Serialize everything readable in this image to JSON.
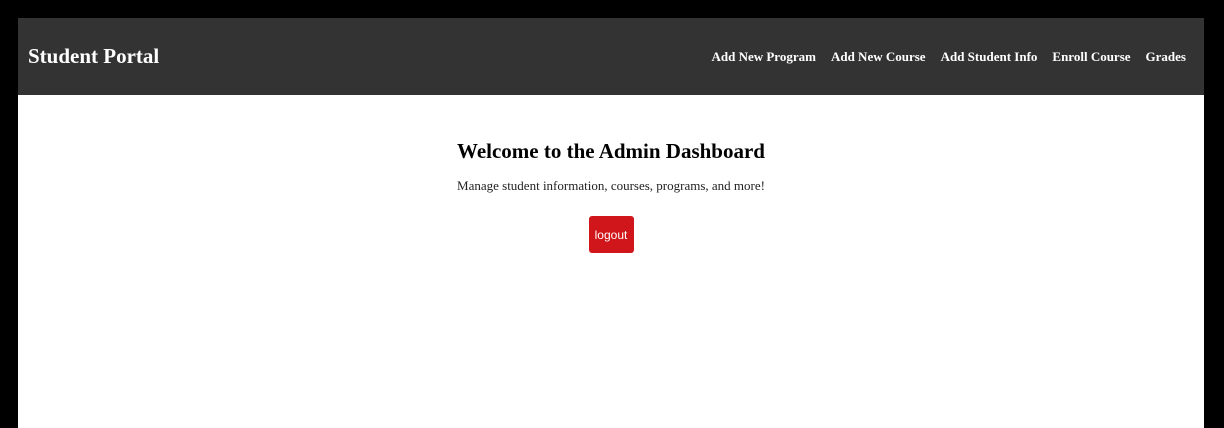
{
  "navbar": {
    "brand": "Student Portal",
    "links": [
      {
        "label": "Add New Program"
      },
      {
        "label": "Add New Course"
      },
      {
        "label": "Add Student Info"
      },
      {
        "label": "Enroll Course"
      },
      {
        "label": "Grades"
      }
    ],
    "background_color": "#333333"
  },
  "main": {
    "title": "Welcome to the Admin Dashboard",
    "subtitle": "Manage student information, courses, programs, and more!",
    "logout_label": "logout",
    "logout_color": "#d0161b"
  }
}
